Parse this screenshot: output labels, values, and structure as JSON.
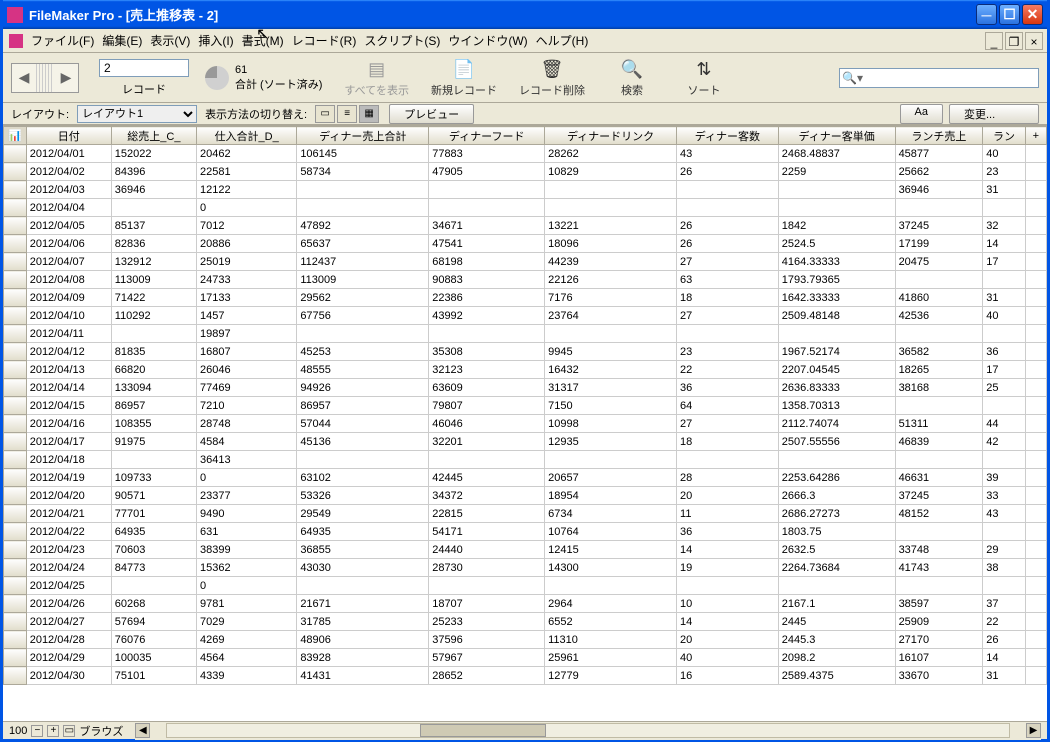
{
  "window": {
    "title": "FileMaker Pro - [売上推移表 - 2]"
  },
  "menus": {
    "file": "ファイル(F)",
    "edit": "編集(E)",
    "view": "表示(V)",
    "insert": "挿入(I)",
    "format": "書式(M)",
    "record": "レコード(R)",
    "script": "スクリプト(S)",
    "window": "ウインドウ(W)",
    "help": "ヘルプ(H)"
  },
  "toolbar": {
    "record_value": "2",
    "record_label": "レコード",
    "total_count": "61",
    "total_label": "合計 (ソート済み)",
    "show_all": "すべてを表示",
    "new_record": "新規レコード",
    "delete_record": "レコード削除",
    "search": "検索",
    "sort": "ソート"
  },
  "layoutbar": {
    "layout_label": "レイアウト:",
    "layout_value": "レイアウト1",
    "switch_label": "表示方法の切り替え:",
    "preview": "プレビュー",
    "aa": "Aa",
    "change": "変更..."
  },
  "columns": [
    "日付",
    "総売上_C_",
    "仕入合計_D_",
    "ディナー売上合計",
    "ディナーフード",
    "ディナードリンク",
    "ディナー客数",
    "ディナー客単価",
    "ランチ売上",
    "ラン"
  ],
  "rows": [
    [
      "2012/04/01",
      "152022",
      "20462",
      "106145",
      "77883",
      "28262",
      "43",
      "2468.48837",
      "45877",
      "40"
    ],
    [
      "2012/04/02",
      "84396",
      "22581",
      "58734",
      "47905",
      "10829",
      "26",
      "2259",
      "25662",
      "23"
    ],
    [
      "2012/04/03",
      "36946",
      "12122",
      "",
      "",
      "",
      "",
      "",
      "36946",
      "31"
    ],
    [
      "2012/04/04",
      "",
      "0",
      "",
      "",
      "",
      "",
      "",
      "",
      ""
    ],
    [
      "2012/04/05",
      "85137",
      "7012",
      "47892",
      "34671",
      "13221",
      "26",
      "1842",
      "37245",
      "32"
    ],
    [
      "2012/04/06",
      "82836",
      "20886",
      "65637",
      "47541",
      "18096",
      "26",
      "2524.5",
      "17199",
      "14"
    ],
    [
      "2012/04/07",
      "132912",
      "25019",
      "112437",
      "68198",
      "44239",
      "27",
      "4164.33333",
      "20475",
      "17"
    ],
    [
      "2012/04/08",
      "113009",
      "24733",
      "113009",
      "90883",
      "22126",
      "63",
      "1793.79365",
      "",
      ""
    ],
    [
      "2012/04/09",
      "71422",
      "17133",
      "29562",
      "22386",
      "7176",
      "18",
      "1642.33333",
      "41860",
      "31"
    ],
    [
      "2012/04/10",
      "110292",
      "1457",
      "67756",
      "43992",
      "23764",
      "27",
      "2509.48148",
      "42536",
      "40"
    ],
    [
      "2012/04/11",
      "",
      "19897",
      "",
      "",
      "",
      "",
      "",
      "",
      ""
    ],
    [
      "2012/04/12",
      "81835",
      "16807",
      "45253",
      "35308",
      "9945",
      "23",
      "1967.52174",
      "36582",
      "36"
    ],
    [
      "2012/04/13",
      "66820",
      "26046",
      "48555",
      "32123",
      "16432",
      "22",
      "2207.04545",
      "18265",
      "17"
    ],
    [
      "2012/04/14",
      "133094",
      "77469",
      "94926",
      "63609",
      "31317",
      "36",
      "2636.83333",
      "38168",
      "25"
    ],
    [
      "2012/04/15",
      "86957",
      "7210",
      "86957",
      "79807",
      "7150",
      "64",
      "1358.70313",
      "",
      ""
    ],
    [
      "2012/04/16",
      "108355",
      "28748",
      "57044",
      "46046",
      "10998",
      "27",
      "2112.74074",
      "51311",
      "44"
    ],
    [
      "2012/04/17",
      "91975",
      "4584",
      "45136",
      "32201",
      "12935",
      "18",
      "2507.55556",
      "46839",
      "42"
    ],
    [
      "2012/04/18",
      "",
      "36413",
      "",
      "",
      "",
      "",
      "",
      "",
      ""
    ],
    [
      "2012/04/19",
      "109733",
      "0",
      "63102",
      "42445",
      "20657",
      "28",
      "2253.64286",
      "46631",
      "39"
    ],
    [
      "2012/04/20",
      "90571",
      "23377",
      "53326",
      "34372",
      "18954",
      "20",
      "2666.3",
      "37245",
      "33"
    ],
    [
      "2012/04/21",
      "77701",
      "9490",
      "29549",
      "22815",
      "6734",
      "11",
      "2686.27273",
      "48152",
      "43"
    ],
    [
      "2012/04/22",
      "64935",
      "631",
      "64935",
      "54171",
      "10764",
      "36",
      "1803.75",
      "",
      ""
    ],
    [
      "2012/04/23",
      "70603",
      "38399",
      "36855",
      "24440",
      "12415",
      "14",
      "2632.5",
      "33748",
      "29"
    ],
    [
      "2012/04/24",
      "84773",
      "15362",
      "43030",
      "28730",
      "14300",
      "19",
      "2264.73684",
      "41743",
      "38"
    ],
    [
      "2012/04/25",
      "",
      "0",
      "",
      "",
      "",
      "",
      "",
      "",
      ""
    ],
    [
      "2012/04/26",
      "60268",
      "9781",
      "21671",
      "18707",
      "2964",
      "10",
      "2167.1",
      "38597",
      "37"
    ],
    [
      "2012/04/27",
      "57694",
      "7029",
      "31785",
      "25233",
      "6552",
      "14",
      "2445",
      "25909",
      "22"
    ],
    [
      "2012/04/28",
      "76076",
      "4269",
      "48906",
      "37596",
      "11310",
      "20",
      "2445.3",
      "27170",
      "26"
    ],
    [
      "2012/04/29",
      "100035",
      "4564",
      "83928",
      "57967",
      "25961",
      "40",
      "2098.2",
      "16107",
      "14"
    ],
    [
      "2012/04/30",
      "75101",
      "4339",
      "41431",
      "28652",
      "12779",
      "16",
      "2589.4375",
      "33670",
      "31"
    ]
  ],
  "status": {
    "zoom": "100",
    "mode": "ブラウズ"
  }
}
